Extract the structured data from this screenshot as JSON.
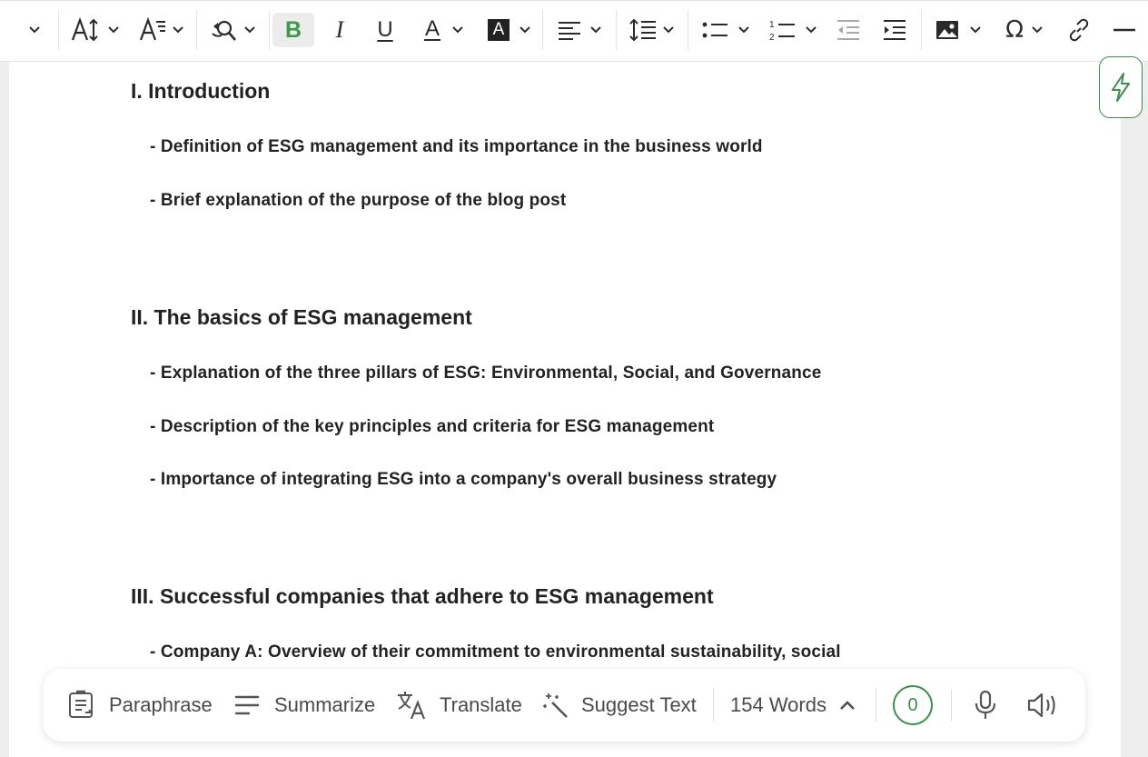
{
  "toolbar": {
    "bold": "B",
    "italic": "I",
    "underline": "U",
    "font_color": "A",
    "highlight": "A",
    "special_char": "Ω"
  },
  "document": {
    "sections": [
      {
        "heading": "I. Introduction",
        "items": [
          "- Definition of ESG management and its importance in the business world",
          "- Brief explanation of the purpose of the blog post"
        ]
      },
      {
        "heading": "II. The basics of ESG management",
        "items": [
          "- Explanation of the three pillars of ESG: Environmental, Social, and Governance",
          "- Description of the key principles and criteria for ESG management",
          "- Importance of integrating ESG into a company's overall business strategy"
        ]
      },
      {
        "heading": "III. Successful companies that adhere to ESG management",
        "items": [
          "- Company A: Overview of their commitment to environmental sustainability, social"
        ]
      }
    ]
  },
  "actionbar": {
    "paraphrase": "Paraphrase",
    "summarize": "Summarize",
    "translate": "Translate",
    "suggest": "Suggest Text",
    "word_count": "154 Words",
    "score": "0"
  },
  "colors": {
    "accent_green": "#3b8f4b",
    "bold_active_green": "#3b9a4a",
    "text": "#222222"
  },
  "icons": [
    "chevron-down-icon",
    "font-size-icon",
    "text-format-icon",
    "find-replace-icon",
    "align-left-icon",
    "line-height-icon",
    "bullet-list-icon",
    "numbered-list-icon",
    "outdent-icon",
    "indent-icon",
    "image-icon",
    "link-icon",
    "horizontal-rule-icon",
    "flash-icon",
    "paraphrase-icon",
    "summarize-icon",
    "translate-icon",
    "magic-wand-icon",
    "chevron-up-icon",
    "microphone-icon",
    "speaker-icon"
  ]
}
